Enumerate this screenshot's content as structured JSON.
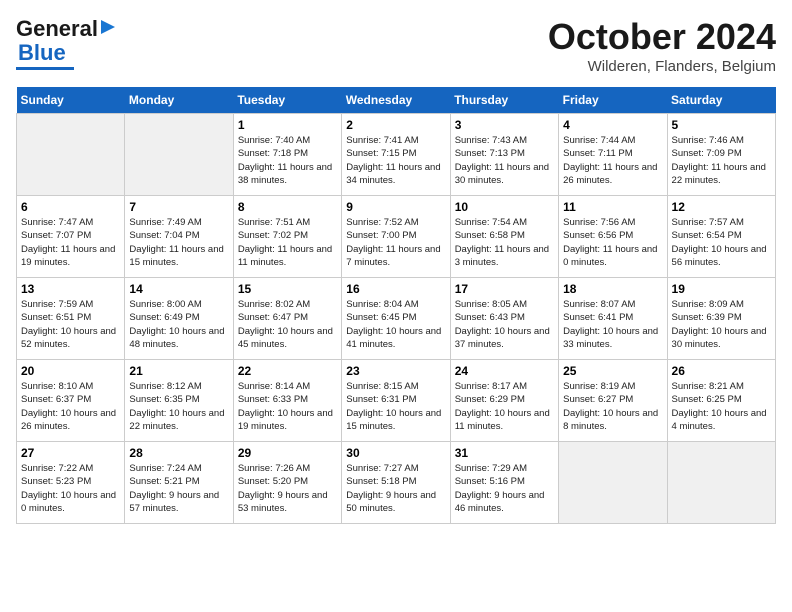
{
  "header": {
    "logo_line1": "General",
    "logo_line2": "Blue",
    "month_title": "October 2024",
    "location": "Wilderen, Flanders, Belgium"
  },
  "days_of_week": [
    "Sunday",
    "Monday",
    "Tuesday",
    "Wednesday",
    "Thursday",
    "Friday",
    "Saturday"
  ],
  "weeks": [
    [
      {
        "day": "",
        "empty": true
      },
      {
        "day": "",
        "empty": true
      },
      {
        "day": "1",
        "sunrise": "Sunrise: 7:40 AM",
        "sunset": "Sunset: 7:18 PM",
        "daylight": "Daylight: 11 hours and 38 minutes."
      },
      {
        "day": "2",
        "sunrise": "Sunrise: 7:41 AM",
        "sunset": "Sunset: 7:15 PM",
        "daylight": "Daylight: 11 hours and 34 minutes."
      },
      {
        "day": "3",
        "sunrise": "Sunrise: 7:43 AM",
        "sunset": "Sunset: 7:13 PM",
        "daylight": "Daylight: 11 hours and 30 minutes."
      },
      {
        "day": "4",
        "sunrise": "Sunrise: 7:44 AM",
        "sunset": "Sunset: 7:11 PM",
        "daylight": "Daylight: 11 hours and 26 minutes."
      },
      {
        "day": "5",
        "sunrise": "Sunrise: 7:46 AM",
        "sunset": "Sunset: 7:09 PM",
        "daylight": "Daylight: 11 hours and 22 minutes."
      }
    ],
    [
      {
        "day": "6",
        "sunrise": "Sunrise: 7:47 AM",
        "sunset": "Sunset: 7:07 PM",
        "daylight": "Daylight: 11 hours and 19 minutes."
      },
      {
        "day": "7",
        "sunrise": "Sunrise: 7:49 AM",
        "sunset": "Sunset: 7:04 PM",
        "daylight": "Daylight: 11 hours and 15 minutes."
      },
      {
        "day": "8",
        "sunrise": "Sunrise: 7:51 AM",
        "sunset": "Sunset: 7:02 PM",
        "daylight": "Daylight: 11 hours and 11 minutes."
      },
      {
        "day": "9",
        "sunrise": "Sunrise: 7:52 AM",
        "sunset": "Sunset: 7:00 PM",
        "daylight": "Daylight: 11 hours and 7 minutes."
      },
      {
        "day": "10",
        "sunrise": "Sunrise: 7:54 AM",
        "sunset": "Sunset: 6:58 PM",
        "daylight": "Daylight: 11 hours and 3 minutes."
      },
      {
        "day": "11",
        "sunrise": "Sunrise: 7:56 AM",
        "sunset": "Sunset: 6:56 PM",
        "daylight": "Daylight: 11 hours and 0 minutes."
      },
      {
        "day": "12",
        "sunrise": "Sunrise: 7:57 AM",
        "sunset": "Sunset: 6:54 PM",
        "daylight": "Daylight: 10 hours and 56 minutes."
      }
    ],
    [
      {
        "day": "13",
        "sunrise": "Sunrise: 7:59 AM",
        "sunset": "Sunset: 6:51 PM",
        "daylight": "Daylight: 10 hours and 52 minutes."
      },
      {
        "day": "14",
        "sunrise": "Sunrise: 8:00 AM",
        "sunset": "Sunset: 6:49 PM",
        "daylight": "Daylight: 10 hours and 48 minutes."
      },
      {
        "day": "15",
        "sunrise": "Sunrise: 8:02 AM",
        "sunset": "Sunset: 6:47 PM",
        "daylight": "Daylight: 10 hours and 45 minutes."
      },
      {
        "day": "16",
        "sunrise": "Sunrise: 8:04 AM",
        "sunset": "Sunset: 6:45 PM",
        "daylight": "Daylight: 10 hours and 41 minutes."
      },
      {
        "day": "17",
        "sunrise": "Sunrise: 8:05 AM",
        "sunset": "Sunset: 6:43 PM",
        "daylight": "Daylight: 10 hours and 37 minutes."
      },
      {
        "day": "18",
        "sunrise": "Sunrise: 8:07 AM",
        "sunset": "Sunset: 6:41 PM",
        "daylight": "Daylight: 10 hours and 33 minutes."
      },
      {
        "day": "19",
        "sunrise": "Sunrise: 8:09 AM",
        "sunset": "Sunset: 6:39 PM",
        "daylight": "Daylight: 10 hours and 30 minutes."
      }
    ],
    [
      {
        "day": "20",
        "sunrise": "Sunrise: 8:10 AM",
        "sunset": "Sunset: 6:37 PM",
        "daylight": "Daylight: 10 hours and 26 minutes."
      },
      {
        "day": "21",
        "sunrise": "Sunrise: 8:12 AM",
        "sunset": "Sunset: 6:35 PM",
        "daylight": "Daylight: 10 hours and 22 minutes."
      },
      {
        "day": "22",
        "sunrise": "Sunrise: 8:14 AM",
        "sunset": "Sunset: 6:33 PM",
        "daylight": "Daylight: 10 hours and 19 minutes."
      },
      {
        "day": "23",
        "sunrise": "Sunrise: 8:15 AM",
        "sunset": "Sunset: 6:31 PM",
        "daylight": "Daylight: 10 hours and 15 minutes."
      },
      {
        "day": "24",
        "sunrise": "Sunrise: 8:17 AM",
        "sunset": "Sunset: 6:29 PM",
        "daylight": "Daylight: 10 hours and 11 minutes."
      },
      {
        "day": "25",
        "sunrise": "Sunrise: 8:19 AM",
        "sunset": "Sunset: 6:27 PM",
        "daylight": "Daylight: 10 hours and 8 minutes."
      },
      {
        "day": "26",
        "sunrise": "Sunrise: 8:21 AM",
        "sunset": "Sunset: 6:25 PM",
        "daylight": "Daylight: 10 hours and 4 minutes."
      }
    ],
    [
      {
        "day": "27",
        "sunrise": "Sunrise: 7:22 AM",
        "sunset": "Sunset: 5:23 PM",
        "daylight": "Daylight: 10 hours and 0 minutes."
      },
      {
        "day": "28",
        "sunrise": "Sunrise: 7:24 AM",
        "sunset": "Sunset: 5:21 PM",
        "daylight": "Daylight: 9 hours and 57 minutes."
      },
      {
        "day": "29",
        "sunrise": "Sunrise: 7:26 AM",
        "sunset": "Sunset: 5:20 PM",
        "daylight": "Daylight: 9 hours and 53 minutes."
      },
      {
        "day": "30",
        "sunrise": "Sunrise: 7:27 AM",
        "sunset": "Sunset: 5:18 PM",
        "daylight": "Daylight: 9 hours and 50 minutes."
      },
      {
        "day": "31",
        "sunrise": "Sunrise: 7:29 AM",
        "sunset": "Sunset: 5:16 PM",
        "daylight": "Daylight: 9 hours and 46 minutes."
      },
      {
        "day": "",
        "empty": true
      },
      {
        "day": "",
        "empty": true
      }
    ]
  ]
}
